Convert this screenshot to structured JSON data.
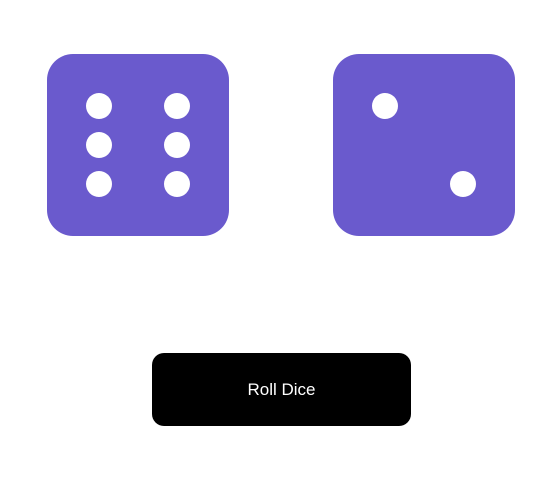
{
  "dice": [
    {
      "value": 6,
      "color": "#6a5acd"
    },
    {
      "value": 2,
      "color": "#6a5acd"
    }
  ],
  "pip_color": "#ffffff",
  "roll_button": {
    "label": "Roll Dice",
    "background": "#000000",
    "text_color": "#ffffff"
  }
}
